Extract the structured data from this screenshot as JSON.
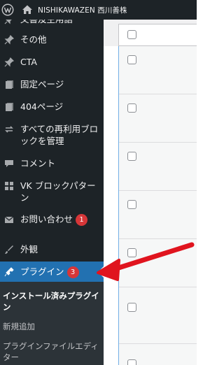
{
  "admin_bar": {
    "site_name": "NISHIKAWAZEN 西川善株"
  },
  "sidebar": {
    "items": [
      {
        "label": "文書及主用語",
        "icon": "pin-icon"
      },
      {
        "label": "その他",
        "icon": "pin-icon"
      },
      {
        "label": "CTA",
        "icon": "pin-icon"
      },
      {
        "label": "固定ページ",
        "icon": "page-icon"
      },
      {
        "label": "404ページ",
        "icon": "page-icon"
      },
      {
        "label": "すべての再利用ブロックを管理",
        "icon": "reusable-block-icon"
      },
      {
        "label": "コメント",
        "icon": "comment-icon"
      },
      {
        "label": "VK ブロックパターン",
        "icon": "grid-icon"
      },
      {
        "label": "お問い合わせ",
        "icon": "mail-icon",
        "badge": "1"
      },
      {
        "label": "外観",
        "icon": "appearance-icon"
      },
      {
        "label": "プラグイン",
        "icon": "plugin-icon",
        "badge": "3",
        "active": true
      }
    ],
    "submenu": [
      {
        "label": "インストール済みプラグイン",
        "current": true
      },
      {
        "label": "新規追加"
      },
      {
        "label": "プラグインファイルエディター"
      }
    ]
  },
  "colors": {
    "sidebar_bg": "#1d2327",
    "active_bg": "#2271b1",
    "badge": "#d63638",
    "annotation_arrow": "#e0141e"
  }
}
